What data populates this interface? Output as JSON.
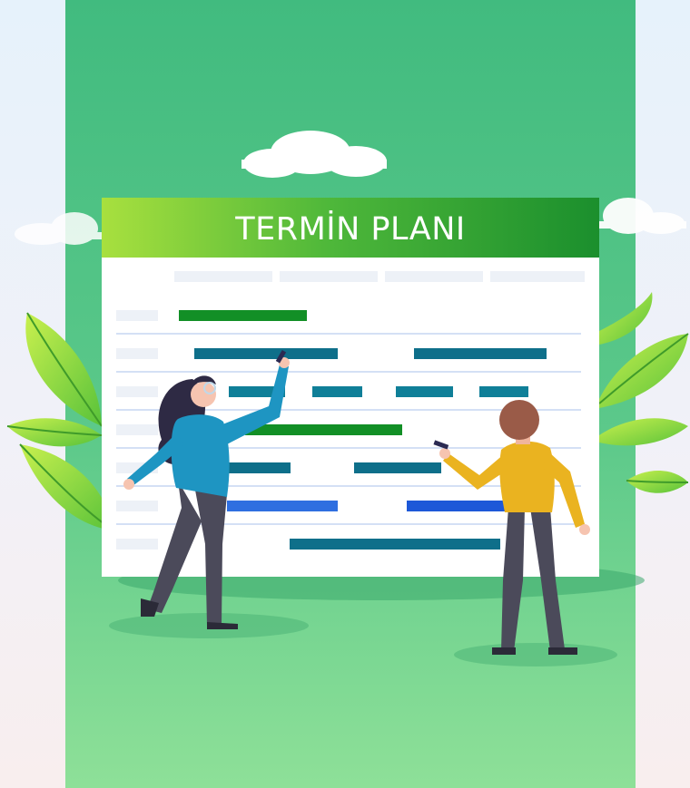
{
  "board": {
    "title": "TERMİN PLANI"
  },
  "colors": {
    "panel_top": "#41bb7f",
    "panel_bottom": "#8ee098",
    "header_left": "#a8e03e",
    "header_right": "#1b8f2d",
    "bar_green": "#128f26",
    "bar_teal": "#0e6f8a",
    "bar_blue": "#2f6fe0",
    "grid_line": "#c6d5f2",
    "leaf": "#8edc3a",
    "woman_shirt": "#1e95c2",
    "man_shirt": "#eab320",
    "pants": "#4b4a5a",
    "hair": "#2e2a44"
  },
  "icons": [
    "cloud-icon",
    "leaf-icon",
    "marker-icon"
  ]
}
